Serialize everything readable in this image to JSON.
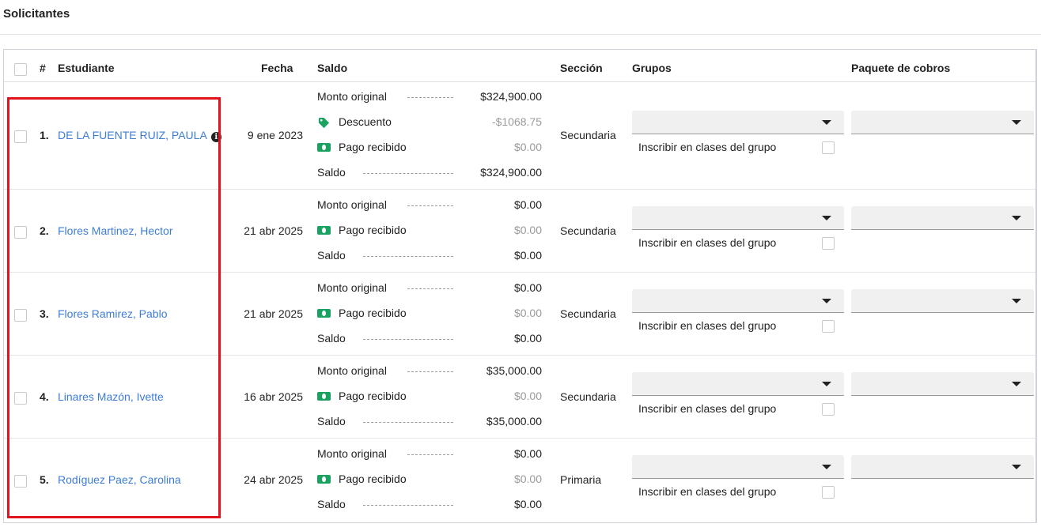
{
  "page": {
    "title": "Solicitantes"
  },
  "table": {
    "headers": {
      "number": "#",
      "student": "Estudiante",
      "date": "Fecha",
      "balance": "Saldo",
      "section": "Sección",
      "groups": "Grupos",
      "payment_package": "Paquete de cobros"
    },
    "rows": [
      {
        "index": "1.",
        "student": "DE LA FUENTE RUIZ, PAULA",
        "has_info_icon": true,
        "date": "9 ene 2023",
        "balance": {
          "original_label": "Monto original",
          "original_amount": "$324,900.00",
          "discount_label": "Descuento",
          "discount_amount": "-$1068.75",
          "payment_label": "Pago recibido",
          "payment_amount": "$0.00",
          "balance_label": "Saldo",
          "balance_amount": "$324,900.00"
        },
        "section": "Secundaria",
        "groups_value": "",
        "enroll_label": "Inscribir en clases del grupo",
        "enroll_checked": false,
        "package_value": ""
      },
      {
        "index": "2.",
        "student": "Flores Martinez, Hector",
        "date": "21 abr 2025",
        "balance": {
          "original_label": "Monto original",
          "original_amount": "$0.00",
          "payment_label": "Pago recibido",
          "payment_amount": "$0.00",
          "balance_label": "Saldo",
          "balance_amount": "$0.00"
        },
        "section": "Secundaria",
        "groups_value": "",
        "enroll_label": "Inscribir en clases del grupo",
        "enroll_checked": false,
        "package_value": ""
      },
      {
        "index": "3.",
        "student": "Flores Ramirez, Pablo",
        "date": "21 abr 2025",
        "balance": {
          "original_label": "Monto original",
          "original_amount": "$0.00",
          "payment_label": "Pago recibido",
          "payment_amount": "$0.00",
          "balance_label": "Saldo",
          "balance_amount": "$0.00"
        },
        "section": "Secundaria",
        "groups_value": "",
        "enroll_label": "Inscribir en clases del grupo",
        "enroll_checked": false,
        "package_value": ""
      },
      {
        "index": "4.",
        "student": "Linares Mazón, Ivette",
        "date": "16 abr 2025",
        "balance": {
          "original_label": "Monto original",
          "original_amount": "$35,000.00",
          "payment_label": "Pago recibido",
          "payment_amount": "$0.00",
          "balance_label": "Saldo",
          "balance_amount": "$35,000.00"
        },
        "section": "Secundaria",
        "groups_value": "",
        "enroll_label": "Inscribir en clases del grupo",
        "enroll_checked": false,
        "package_value": ""
      },
      {
        "index": "5.",
        "student": "Rodíguez Paez, Carolina",
        "date": "24 abr 2025",
        "balance": {
          "original_label": "Monto original",
          "original_amount": "$0.00",
          "payment_label": "Pago recibido",
          "payment_amount": "$0.00",
          "balance_label": "Saldo",
          "balance_amount": "$0.00"
        },
        "section": "Primaria",
        "groups_value": "",
        "enroll_label": "Inscribir en clases del grupo",
        "enroll_checked": false,
        "package_value": ""
      }
    ]
  },
  "colors": {
    "link": "#3d7cd6",
    "discount_tag": "#1aa260",
    "money_icon": "#1aa260",
    "highlight": "#e0141e"
  },
  "icons": {
    "info": "info-icon",
    "discount": "tag-icon",
    "payment": "money-bill-icon",
    "dropdown": "caret-down-icon"
  }
}
